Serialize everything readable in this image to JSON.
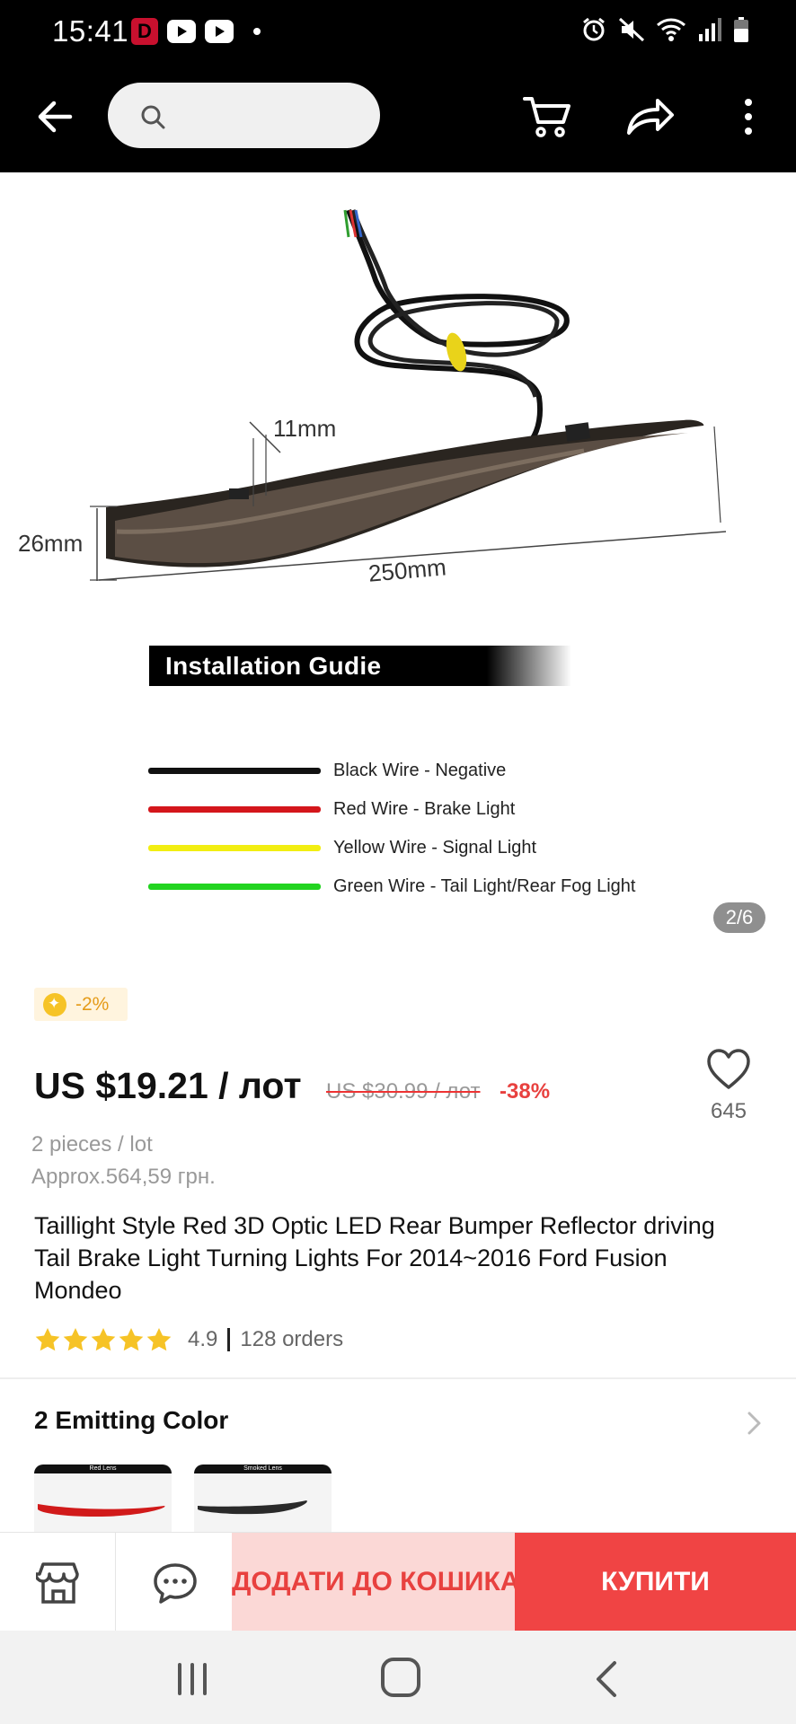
{
  "status_bar": {
    "time": "15:41",
    "badge_letter": "D"
  },
  "search": {
    "placeholder": ""
  },
  "product_image": {
    "dimensions": {
      "height_label": "26mm",
      "depth_label": "11mm",
      "length_label": "250mm"
    },
    "banner": "Installation Gudie",
    "wires": [
      {
        "color": "#111111",
        "label": "Black Wire - Negative"
      },
      {
        "color": "#d4161b",
        "label": "Red Wire - Brake Light"
      },
      {
        "color": "#f2ee12",
        "label": "Yellow Wire - Signal Light"
      },
      {
        "color": "#22d420",
        "label": "Green Wire - Tail Light/Rear Fog Light"
      }
    ],
    "counter": "2/6"
  },
  "coin": {
    "discount": "-2%"
  },
  "price": {
    "current": "US $19.21 / лот",
    "original": "US $30.99 / лот",
    "discount": "-38%"
  },
  "wishlist": {
    "count": "645"
  },
  "lot_info": "2 pieces / lot",
  "approx_price": "Approx.564,59 грн.",
  "title": "Taillight Style Red 3D Optic LED Rear Bumper Reflector driving Tail Brake Light Turning Lights For 2014~2016 Ford Fusion Mondeo",
  "rating": {
    "value": "4.9",
    "orders": "128 orders",
    "stars": 5
  },
  "variants": {
    "header": "2 Emitting Color",
    "options": [
      {
        "label": "Red Lens",
        "color": "#d11a1a"
      },
      {
        "label": "Smoked Lens",
        "color": "#2a2a2a"
      }
    ]
  },
  "actions": {
    "add_to_cart": "ДОДАТИ ДО КОШИКА",
    "buy": "КУПИТИ"
  },
  "colors": {
    "accent": "#f04444",
    "accent_light": "#fbd8d6",
    "star": "#f6c326"
  }
}
